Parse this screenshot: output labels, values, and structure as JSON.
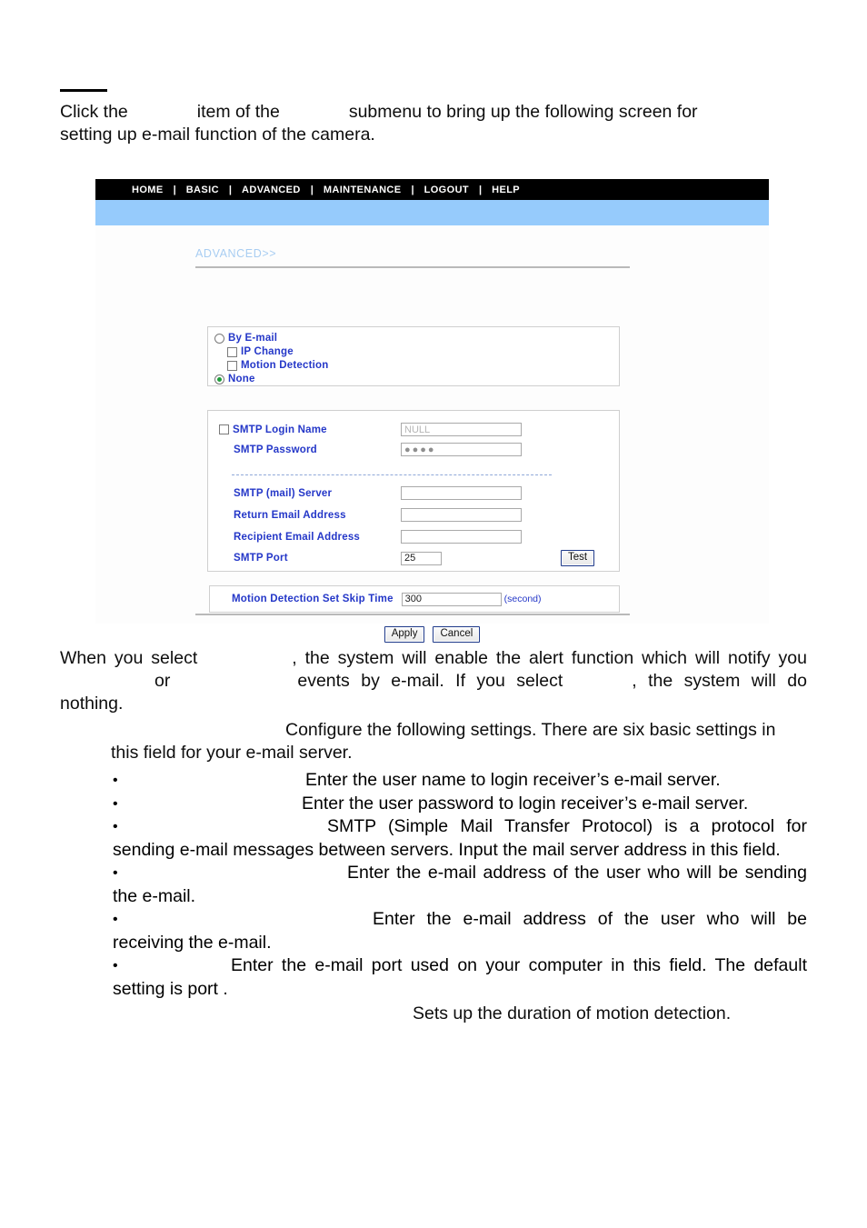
{
  "document": {
    "intro": {
      "lead_line_1_a": "Click the",
      "lead_line_1_b": "item of the",
      "lead_line_1_c": "submenu to bring up the following screen for",
      "lead_line_2": "setting up e-mail function of the camera."
    },
    "paragraph_2": {
      "a": "When you select",
      "b": ", the system will enable the alert function which will notify you",
      "c": "or",
      "d": "events by e-mail.  If you select",
      "e": ", the system will do nothing."
    },
    "paragraph_3": {
      "a": "Configure the following settings.  There are six basic settings in this field for your e-mail server."
    },
    "bullets": [
      {
        "text": "Enter the user name to login receiver’s e-mail server."
      },
      {
        "text": "Enter the user password to login receiver’s e-mail server."
      },
      {
        "text": "SMTP (Simple Mail Transfer Protocol) is a protocol for sending e-mail messages between servers.  Input the mail server address in this field."
      },
      {
        "text": "Enter the e-mail address of the user who will be sending the e-mail."
      },
      {
        "text": "Enter the e-mail address of the user who will be receiving the e-mail."
      },
      {
        "text": "Enter the e-mail port used on your computer in this field.  The default setting is port    ."
      }
    ],
    "closing_line": "Sets up the duration of motion detection."
  },
  "screenshot": {
    "navbar": {
      "items": [
        "HOME",
        "BASIC",
        "ADVANCED",
        "MAINTENANCE",
        "LOGOUT",
        "HELP"
      ],
      "separator": "|",
      "background": "#000000",
      "text_color": "#ffffff"
    },
    "subnav": {
      "background": "#96cbfc"
    },
    "breadcrumb": {
      "label": "ADVANCED>>",
      "color": "#a8cdf2"
    },
    "alert_options": {
      "by_email": {
        "label": "By E-mail",
        "type": "radio",
        "selected": false
      },
      "ip_change": {
        "label": "IP Change",
        "type": "checkbox",
        "checked": false
      },
      "motion_detection": {
        "label": "Motion Detection",
        "type": "checkbox",
        "checked": false
      },
      "none": {
        "label": "None",
        "type": "radio",
        "selected": true
      }
    },
    "smtp": {
      "login_name": {
        "label": "SMTP Login Name",
        "value": "NULL",
        "checkbox_checked": false
      },
      "password": {
        "label": "SMTP Password",
        "value": "●●●●"
      },
      "mail_server": {
        "label": "SMTP (mail) Server",
        "value": ""
      },
      "return_email": {
        "label": "Return Email Address",
        "value": ""
      },
      "recipient_email": {
        "label": "Recipient Email Address",
        "value": ""
      },
      "port": {
        "label": "SMTP Port",
        "value": "25"
      },
      "test_button": "Test"
    },
    "skip_time": {
      "label": "Motion Detection Set Skip Time",
      "value": "300",
      "unit": "(second)"
    },
    "buttons": {
      "apply": "Apply",
      "cancel": "Cancel"
    },
    "label_color": "#2437c8"
  }
}
